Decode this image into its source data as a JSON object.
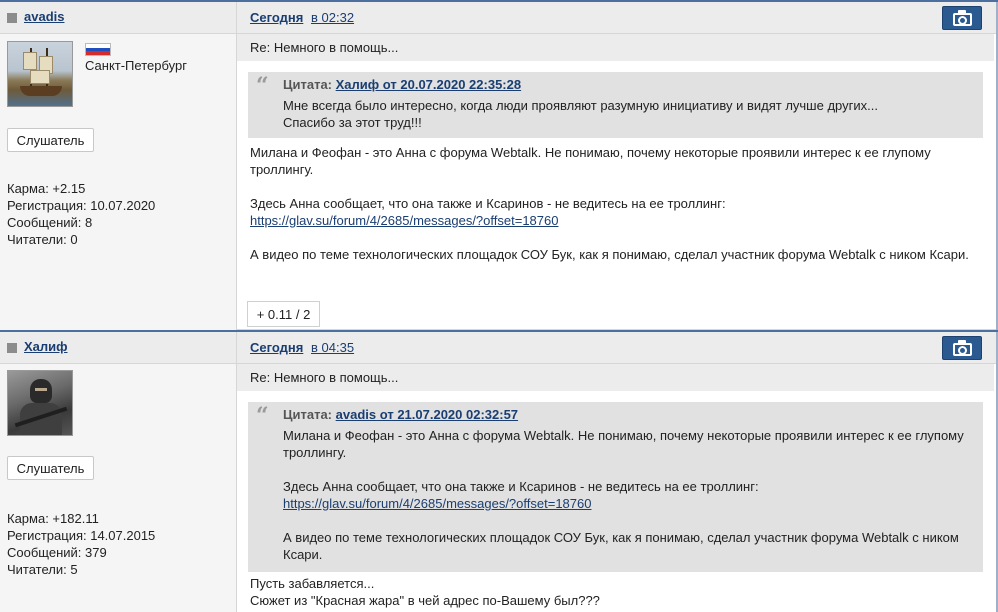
{
  "posts": [
    {
      "author": "avadis",
      "date_label": "Сегодня",
      "time_label": "в 02:32",
      "camera_icon": "camera-icon",
      "avatar_icon": "ship-avatar",
      "flag_icon": "russia-flag-icon",
      "location": "Санкт-Петербург",
      "rank": "Слушатель",
      "stats": {
        "karma": "Карма: +2.15",
        "registered": "Регистрация: 10.07.2020",
        "messages": "Сообщений: 8",
        "readers": "Читатели: 0"
      },
      "subject": "Re: Немного в помощь...",
      "quote": {
        "prefix": "Цитата:",
        "who": "Халиф от 20.07.2020 22:35:28",
        "lines": [
          "Мне всегда было интересно, когда люди проявляют разумную инициативу и видят лучше других...",
          "Спасибо за этот труд!!!"
        ]
      },
      "body": {
        "p1": "Милана и Феофан - это Анна с форума Webtalk. Не понимаю, почему некоторые проявили интерес к ее глупому троллингу.",
        "p2": "Здесь Анна сообщает, что она также и Ксаринов - не ведитесь на ее троллинг:",
        "link": "https://glav.su/forum/4/2685/messages/?offset=18760",
        "p3": "А видео по теме технологических площадок СОУ Бук, как я понимаю, сделал участник форума Webtalk с ником Ксари."
      },
      "rating": "+ 0.11 / 2"
    },
    {
      "author": "Халиф",
      "date_label": "Сегодня",
      "time_label": "в 04:35",
      "camera_icon": "camera-icon",
      "avatar_icon": "soldier-avatar",
      "rank": "Слушатель",
      "stats": {
        "karma": "Карма: +182.11",
        "registered": "Регистрация: 14.07.2015",
        "messages": "Сообщений: 379",
        "readers": "Читатели: 5"
      },
      "subject": "Re: Немного в помощь...",
      "quote": {
        "prefix": "Цитата:",
        "who": "avadis от 21.07.2020 02:32:57",
        "p1": "Милана и Феофан - это Анна с форума Webtalk. Не понимаю, почему некоторые проявили интерес к ее глупому троллингу.",
        "p2": "Здесь Анна сообщает, что она также и Ксаринов - не ведитесь на ее троллинг:",
        "link": "https://glav.su/forum/4/2685/messages/?offset=18760",
        "p3": "А видео по теме технологических площадок СОУ Бук, как я понимаю, сделал участник форума Webtalk с ником Ксари."
      },
      "body": {
        "line1": "Пусть забавляется...",
        "line2": "Сюжет из \"Красная жара\" в чей адрес по-Вашему был???"
      }
    }
  ],
  "colors": {
    "link": "#1a3e72",
    "header_bg": "#ececec",
    "quote_bg": "#e1e1e1",
    "camera_button": "#2a5a8f",
    "post_border": "#4d6fa0"
  }
}
